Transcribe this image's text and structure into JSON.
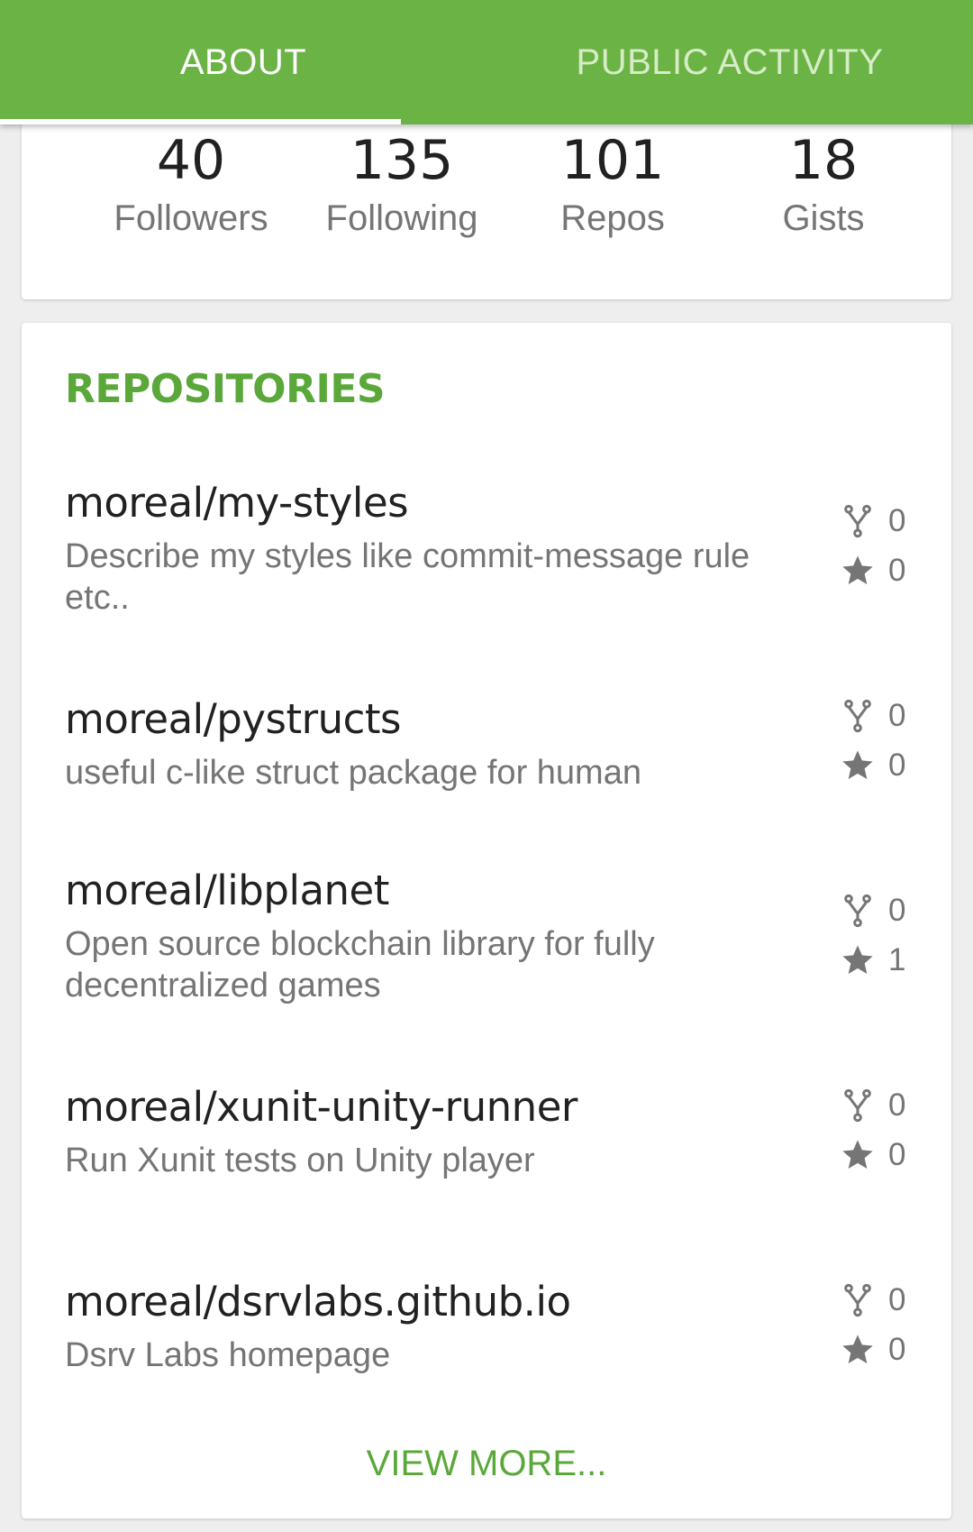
{
  "tabs": [
    {
      "label": "ABOUT",
      "active": true
    },
    {
      "label": "PUBLIC ACTIVITY",
      "active": false
    }
  ],
  "stats": [
    {
      "value": "40",
      "label": "Followers"
    },
    {
      "value": "135",
      "label": "Following"
    },
    {
      "value": "101",
      "label": "Repos"
    },
    {
      "value": "18",
      "label": "Gists"
    }
  ],
  "repositories": {
    "title": "REPOSITORIES",
    "items": [
      {
        "name": "moreal/my-styles",
        "description": "Describe my styles like commit-message rule etc..",
        "forks": "0",
        "stars": "0"
      },
      {
        "name": "moreal/pystructs",
        "description": "useful c-like struct package for human",
        "forks": "0",
        "stars": "0"
      },
      {
        "name": "moreal/libplanet",
        "description": "Open source blockchain library for fully decentralized games",
        "forks": "0",
        "stars": "1"
      },
      {
        "name": "moreal/xunit-unity-runner",
        "description": "Run Xunit tests on Unity player",
        "forks": "0",
        "stars": "0"
      },
      {
        "name": "moreal/dsrvlabs.github.io",
        "description": "Dsrv Labs homepage",
        "forks": "0",
        "stars": "0"
      }
    ],
    "view_more": "VIEW MORE..."
  },
  "colors": {
    "accent": "#6bb345",
    "section_title": "#5aa83a",
    "icon_gray": "#757575"
  },
  "icons": {
    "fork": "fork-icon",
    "star": "star-icon"
  }
}
